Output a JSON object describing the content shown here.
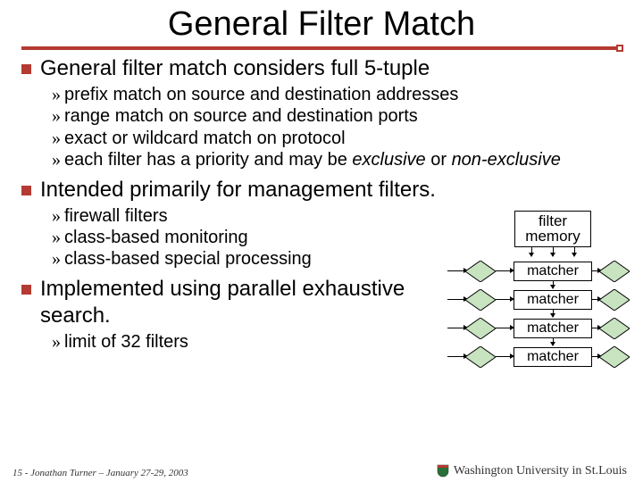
{
  "title": "General Filter Match",
  "bullets": [
    {
      "text": "General filter match considers full 5-tuple",
      "subs": [
        {
          "pre": "prefix match on source and destination addresses"
        },
        {
          "pre": "range match on source and destination ports"
        },
        {
          "pre": "exact or wildcard match on protocol"
        },
        {
          "html": "each filter has a priority and may be <span class=\"em\">exclusive</span> or <span class=\"em\">non-exclusive</span>"
        }
      ]
    },
    {
      "text": "Intended primarily for management filters.",
      "subs": [
        {
          "pre": "firewall filters"
        },
        {
          "pre": "class-based monitoring"
        },
        {
          "pre": "class-based special processing"
        }
      ]
    },
    {
      "text": "Implemented using parallel exhaustive search.",
      "subs": [
        {
          "pre": "limit of 32 filters"
        }
      ]
    }
  ],
  "diagram": {
    "filter_memory_label": "filter memory",
    "matcher_label": "matcher",
    "matcher_count": 4
  },
  "footer": {
    "left": "15 - Jonathan Turner – January 27-29, 2003",
    "right": "Washington University in St.Louis",
    "shield_name": "wustl-shield-icon"
  }
}
